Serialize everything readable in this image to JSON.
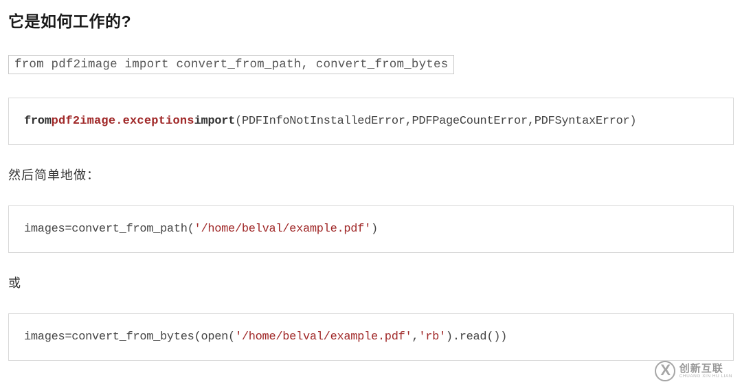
{
  "heading": "它是如何工作的?",
  "code1": "from pdf2image import convert_from_path, convert_from_bytes",
  "code2": {
    "kw1": "from",
    "mod": "pdf2image.exceptions",
    "kw2": "import",
    "rest": "(PDFInfoNotInstalledError,PDFPageCountError,PDFSyntaxError)"
  },
  "text1": "然后简单地做：",
  "code3": {
    "prefix": "images=convert_from_path(",
    "str": "'/home/belval/example.pdf'",
    "suffix": ")"
  },
  "text2": "或",
  "code4": {
    "prefix": "images=convert_from_bytes(open(",
    "str1": "'/home/belval/example.pdf'",
    "comma": ",",
    "str2": "'rb'",
    "suffix": ").read())"
  },
  "logo": {
    "cn": "创新互联",
    "en": "CHUANG XIN HU LIAN"
  }
}
